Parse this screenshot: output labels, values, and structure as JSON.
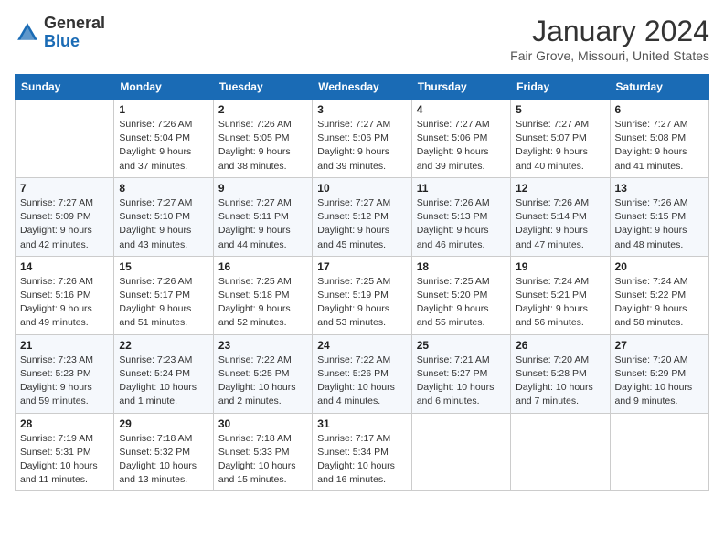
{
  "header": {
    "logo": {
      "line1": "General",
      "line2": "Blue"
    },
    "title": "January 2024",
    "location": "Fair Grove, Missouri, United States"
  },
  "weekdays": [
    "Sunday",
    "Monday",
    "Tuesday",
    "Wednesday",
    "Thursday",
    "Friday",
    "Saturday"
  ],
  "weeks": [
    [
      {
        "day": "",
        "sunrise": "",
        "sunset": "",
        "daylight": ""
      },
      {
        "day": "1",
        "sunrise": "Sunrise: 7:26 AM",
        "sunset": "Sunset: 5:04 PM",
        "daylight": "Daylight: 9 hours and 37 minutes."
      },
      {
        "day": "2",
        "sunrise": "Sunrise: 7:26 AM",
        "sunset": "Sunset: 5:05 PM",
        "daylight": "Daylight: 9 hours and 38 minutes."
      },
      {
        "day": "3",
        "sunrise": "Sunrise: 7:27 AM",
        "sunset": "Sunset: 5:06 PM",
        "daylight": "Daylight: 9 hours and 39 minutes."
      },
      {
        "day": "4",
        "sunrise": "Sunrise: 7:27 AM",
        "sunset": "Sunset: 5:06 PM",
        "daylight": "Daylight: 9 hours and 39 minutes."
      },
      {
        "day": "5",
        "sunrise": "Sunrise: 7:27 AM",
        "sunset": "Sunset: 5:07 PM",
        "daylight": "Daylight: 9 hours and 40 minutes."
      },
      {
        "day": "6",
        "sunrise": "Sunrise: 7:27 AM",
        "sunset": "Sunset: 5:08 PM",
        "daylight": "Daylight: 9 hours and 41 minutes."
      }
    ],
    [
      {
        "day": "7",
        "sunrise": "Sunrise: 7:27 AM",
        "sunset": "Sunset: 5:09 PM",
        "daylight": "Daylight: 9 hours and 42 minutes."
      },
      {
        "day": "8",
        "sunrise": "Sunrise: 7:27 AM",
        "sunset": "Sunset: 5:10 PM",
        "daylight": "Daylight: 9 hours and 43 minutes."
      },
      {
        "day": "9",
        "sunrise": "Sunrise: 7:27 AM",
        "sunset": "Sunset: 5:11 PM",
        "daylight": "Daylight: 9 hours and 44 minutes."
      },
      {
        "day": "10",
        "sunrise": "Sunrise: 7:27 AM",
        "sunset": "Sunset: 5:12 PM",
        "daylight": "Daylight: 9 hours and 45 minutes."
      },
      {
        "day": "11",
        "sunrise": "Sunrise: 7:26 AM",
        "sunset": "Sunset: 5:13 PM",
        "daylight": "Daylight: 9 hours and 46 minutes."
      },
      {
        "day": "12",
        "sunrise": "Sunrise: 7:26 AM",
        "sunset": "Sunset: 5:14 PM",
        "daylight": "Daylight: 9 hours and 47 minutes."
      },
      {
        "day": "13",
        "sunrise": "Sunrise: 7:26 AM",
        "sunset": "Sunset: 5:15 PM",
        "daylight": "Daylight: 9 hours and 48 minutes."
      }
    ],
    [
      {
        "day": "14",
        "sunrise": "Sunrise: 7:26 AM",
        "sunset": "Sunset: 5:16 PM",
        "daylight": "Daylight: 9 hours and 49 minutes."
      },
      {
        "day": "15",
        "sunrise": "Sunrise: 7:26 AM",
        "sunset": "Sunset: 5:17 PM",
        "daylight": "Daylight: 9 hours and 51 minutes."
      },
      {
        "day": "16",
        "sunrise": "Sunrise: 7:25 AM",
        "sunset": "Sunset: 5:18 PM",
        "daylight": "Daylight: 9 hours and 52 minutes."
      },
      {
        "day": "17",
        "sunrise": "Sunrise: 7:25 AM",
        "sunset": "Sunset: 5:19 PM",
        "daylight": "Daylight: 9 hours and 53 minutes."
      },
      {
        "day": "18",
        "sunrise": "Sunrise: 7:25 AM",
        "sunset": "Sunset: 5:20 PM",
        "daylight": "Daylight: 9 hours and 55 minutes."
      },
      {
        "day": "19",
        "sunrise": "Sunrise: 7:24 AM",
        "sunset": "Sunset: 5:21 PM",
        "daylight": "Daylight: 9 hours and 56 minutes."
      },
      {
        "day": "20",
        "sunrise": "Sunrise: 7:24 AM",
        "sunset": "Sunset: 5:22 PM",
        "daylight": "Daylight: 9 hours and 58 minutes."
      }
    ],
    [
      {
        "day": "21",
        "sunrise": "Sunrise: 7:23 AM",
        "sunset": "Sunset: 5:23 PM",
        "daylight": "Daylight: 9 hours and 59 minutes."
      },
      {
        "day": "22",
        "sunrise": "Sunrise: 7:23 AM",
        "sunset": "Sunset: 5:24 PM",
        "daylight": "Daylight: 10 hours and 1 minute."
      },
      {
        "day": "23",
        "sunrise": "Sunrise: 7:22 AM",
        "sunset": "Sunset: 5:25 PM",
        "daylight": "Daylight: 10 hours and 2 minutes."
      },
      {
        "day": "24",
        "sunrise": "Sunrise: 7:22 AM",
        "sunset": "Sunset: 5:26 PM",
        "daylight": "Daylight: 10 hours and 4 minutes."
      },
      {
        "day": "25",
        "sunrise": "Sunrise: 7:21 AM",
        "sunset": "Sunset: 5:27 PM",
        "daylight": "Daylight: 10 hours and 6 minutes."
      },
      {
        "day": "26",
        "sunrise": "Sunrise: 7:20 AM",
        "sunset": "Sunset: 5:28 PM",
        "daylight": "Daylight: 10 hours and 7 minutes."
      },
      {
        "day": "27",
        "sunrise": "Sunrise: 7:20 AM",
        "sunset": "Sunset: 5:29 PM",
        "daylight": "Daylight: 10 hours and 9 minutes."
      }
    ],
    [
      {
        "day": "28",
        "sunrise": "Sunrise: 7:19 AM",
        "sunset": "Sunset: 5:31 PM",
        "daylight": "Daylight: 10 hours and 11 minutes."
      },
      {
        "day": "29",
        "sunrise": "Sunrise: 7:18 AM",
        "sunset": "Sunset: 5:32 PM",
        "daylight": "Daylight: 10 hours and 13 minutes."
      },
      {
        "day": "30",
        "sunrise": "Sunrise: 7:18 AM",
        "sunset": "Sunset: 5:33 PM",
        "daylight": "Daylight: 10 hours and 15 minutes."
      },
      {
        "day": "31",
        "sunrise": "Sunrise: 7:17 AM",
        "sunset": "Sunset: 5:34 PM",
        "daylight": "Daylight: 10 hours and 16 minutes."
      },
      {
        "day": "",
        "sunrise": "",
        "sunset": "",
        "daylight": ""
      },
      {
        "day": "",
        "sunrise": "",
        "sunset": "",
        "daylight": ""
      },
      {
        "day": "",
        "sunrise": "",
        "sunset": "",
        "daylight": ""
      }
    ]
  ]
}
